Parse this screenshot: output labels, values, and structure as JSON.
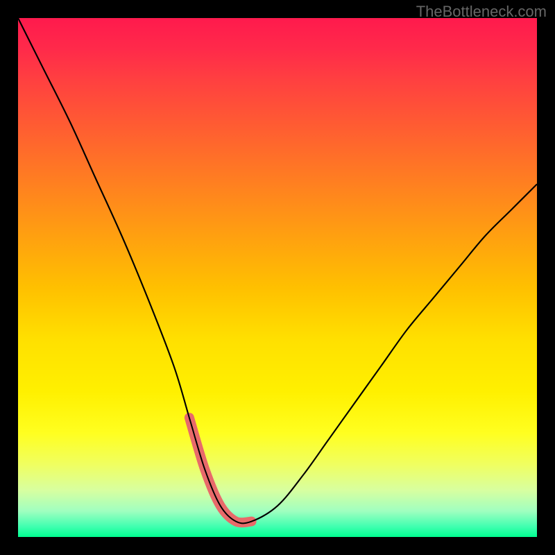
{
  "watermark": "TheBottleneck.com",
  "chart_data": {
    "type": "line",
    "title": "",
    "xlabel": "",
    "ylabel": "",
    "xlim": [
      0,
      100
    ],
    "ylim": [
      0,
      100
    ],
    "series": [
      {
        "name": "bottleneck-curve",
        "x": [
          0,
          5,
          10,
          15,
          20,
          25,
          30,
          33,
          36,
          39,
          42,
          45,
          50,
          55,
          60,
          65,
          70,
          75,
          80,
          85,
          90,
          95,
          100
        ],
        "values": [
          100,
          90,
          80,
          69,
          58,
          46,
          33,
          23,
          13,
          6,
          3,
          3,
          6,
          12,
          19,
          26,
          33,
          40,
          46,
          52,
          58,
          63,
          68
        ]
      },
      {
        "name": "optimal-zone-highlight",
        "x": [
          33,
          36,
          39,
          42,
          45
        ],
        "values": [
          23,
          13,
          6,
          3,
          3
        ]
      }
    ],
    "colors": {
      "curve": "#000000",
      "highlight": "#e86a6a",
      "gradient_top": "#ff1a4d",
      "gradient_bottom": "#00ff90"
    }
  }
}
